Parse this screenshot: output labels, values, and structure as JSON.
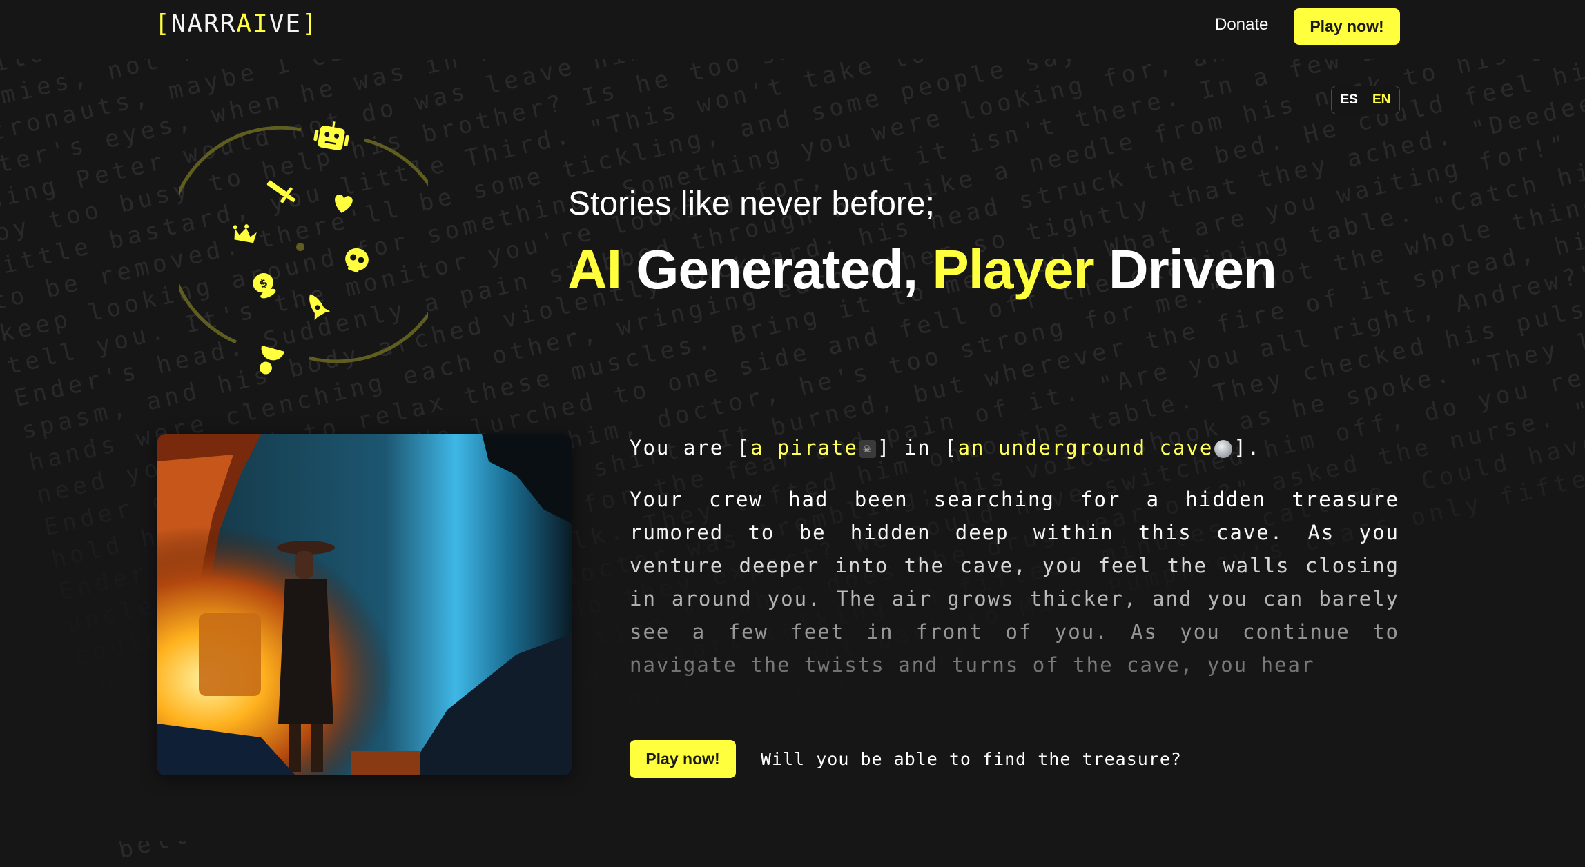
{
  "header": {
    "logo": {
      "open": "[",
      "part1": "NARR",
      "ai": "AI",
      "part2": "VE",
      "close": "]"
    },
    "donate_label": "Donate",
    "play_label": "Play now!"
  },
  "language": {
    "options": [
      "ES",
      "EN"
    ],
    "selected": "EN"
  },
  "hero": {
    "tagline": "Stories like never before;",
    "headline": [
      {
        "text": "AI",
        "highlight": true
      },
      {
        "text": " Generated, ",
        "highlight": false
      },
      {
        "text": "Player",
        "highlight": true
      },
      {
        "text": " Driven",
        "highlight": false
      }
    ]
  },
  "orbit_icons": [
    "robot-icon",
    "heart-icon",
    "skull-icon",
    "rocket-icon",
    "magnet-icon",
    "money-bag-icon",
    "crown-icon",
    "sword-icon"
  ],
  "story": {
    "intro_prefix": "You are [",
    "role": "a pirate",
    "role_icon": "☠",
    "intro_mid": "] in [",
    "place": "an underground cave",
    "intro_suffix": "].",
    "body": "Your crew had been searching for a hidden treasure rumored to be hidden deep within this cave. As you venture deeper into the cave, you feel the walls closing in around you. The air grows thicker, and you can barely see a few feet in front of you. As you continue to navigate the twists and turns of the cave, you hear",
    "image_alt": "Pirate in a glowing underground cave with treasure"
  },
  "cta": {
    "play_label": "Play now!",
    "question": "Will you be able to find the treasure?"
  },
  "background_text": "elf in someone else's the buggers get him, they'll make me too. If the buggers get him, they'll make me take it. \"Andrew, I suppose by now you're just absolutely sick of us.\" Ender nodded. It was a lie, of course, that it won't hurt a bit.\" Ender nodded. It was a lie, of course, that it won't hurt a bit.\" out, and it won't hurt a bit.\" Ender nodded. It was a lie, of course, that it would be the future. Sometimes lies were more dependable than the truth. as an accurate prediction of the future. Sometimes lies were more dependable than the truth. The monitor gone. Ender tried to imagine the little device missing from the back of his neck. doctor will be in to see you in a moment.\" The monitor gone. Ender tried to imagine the little device missing from the back. I'll come home and show him the whole year long. essing there. I won't feel it tingling and taking up the heat when I shower. And Peter won't hate me anymore. I'll come home and show him that I don't have the monitor. ke it, either. That I'll just be a normal kid now, like him. That won't be so bad then. He'll forgive me that I had my monitor a whole year longer than he had his. obably. No, Peter was too dangerous. Peter got so angry. Not enemies, not friends, but brothers-- able to live in the same house. one. And when he wants to play buggers and astronauts, maybe I can just go read a book. But Ender knew, even as he thought it. There was something in Peter's eyes, when he was in his mad mood, and whenever Ender saw that look, that glint, he knew that the one thing Peter would not do was leave him alone. ing piano, Ender. Come turn the pages for me. Oh, is the monitor boy too busy to help his brother? Is he too smart? Got to go kill some buggers, astronaut? do it on my own, you little bastard, you little Third. \"This won't take long, Andrew,\" said the doctor. Ender nodded. \"It's designed to be removed. there'll be some tickling, and some people say they have a feeling of something missing. You'll keep looking around for something. Something you were looking for, and you can't remember what it was. So I'll tell you. It's the monitor you're looking for, but it isn't there. In a few days that feeling will pass. k of Ender's head. Suddenly a pain stabbed through him like a needle from his neck to his groin. Ender felt his back spasm, and his body arched violently backward; his head struck the bed. He could feel his legs thrashing, and his hands were clenching each other, wringing each other so tightly that they ached. \"Deedee!\" shouted the doctor. \"I need you!\" Got to relax these muscles. Bring it to me, now! What are you waiting for!\" Something changed hands; Ender could not see. He lurched to one side and fell off the examining table. \"Catch him!\" cried the nurse. \"Just hold him steady--\" \"You hold him, doctor, he's too strong for me.\" \"Not the whole thing! You'll stop his heart.\" Ender felt a needle enter his shirt. It burned, but wherever the fire of it spread, his muscles gradually unclenched. Now he could cry for the fear and pain of it. \"Are you all right, Andrew?\" the nurse asked. Ender could not remember how to talk. They lifted him onto the table. They checked his pulse, did other things; he did not understand it all. The doctor was trembling; his voice shook as he spoke. \"They leave these things in the kids for three years, what do they expect? We could have switched him off, do you realize that? We could have unplugged his brain for all time.\" \"When does the drug wear off?\" asked the nurse. \"Keep him here for at least an hour. Watch him. If he doesn't start talking in fifteen minutes, call me. Could have unplugged him forever. I don't have the brains of a bugger.\" He got back to Miss Pumphrey's class only fifteen minutes before the last bell. He was still a little unsteady on his feet."
}
